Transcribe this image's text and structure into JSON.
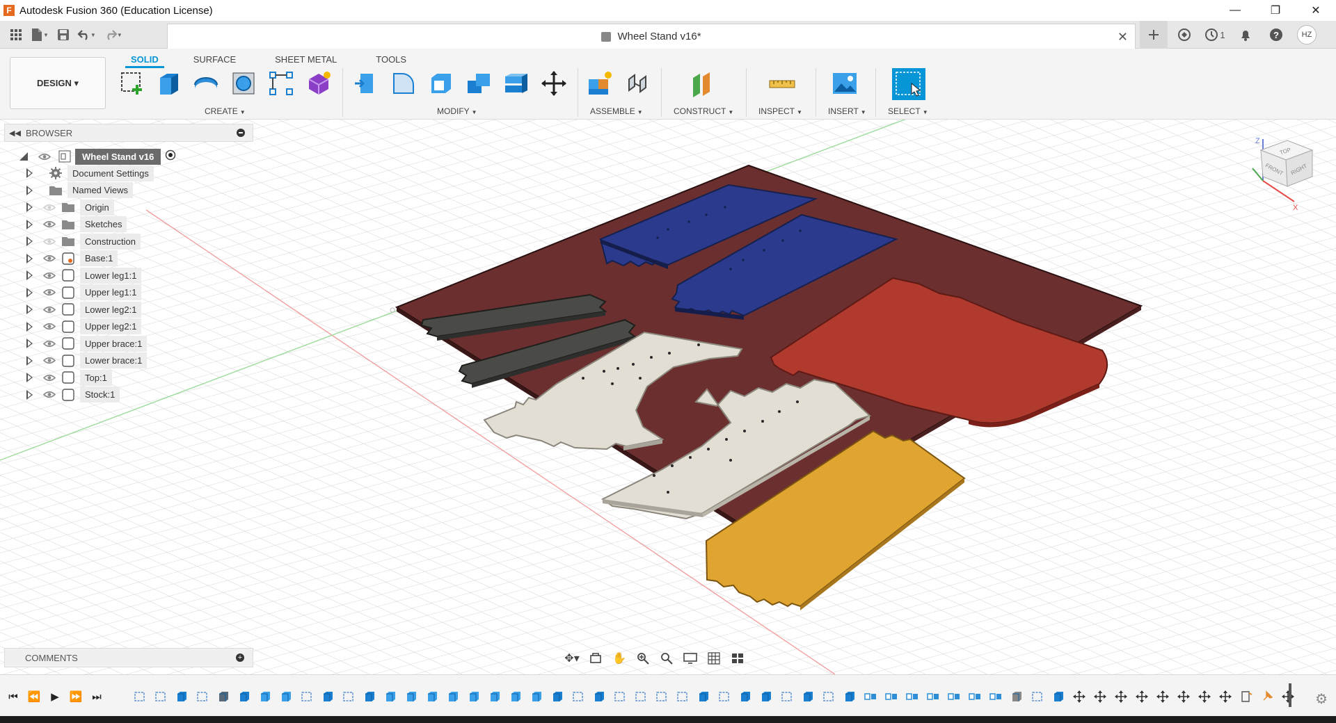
{
  "app": {
    "title": "Autodesk Fusion 360 (Education License)",
    "logo_letter": "F"
  },
  "window_controls": {
    "minimize": "—",
    "maximize": "❐",
    "close": "✕"
  },
  "document": {
    "name": "Wheel Stand v16*",
    "close": "✕"
  },
  "tabstrip_right": {
    "jobs_count": "1",
    "user_initials": "HZ"
  },
  "workspace": {
    "label": "DESIGN ▾"
  },
  "toolbar_tabs": [
    "SOLID",
    "SURFACE",
    "SHEET METAL",
    "TOOLS"
  ],
  "tool_groups": {
    "create": "CREATE",
    "modify": "MODIFY",
    "assemble": "ASSEMBLE",
    "construct": "CONSTRUCT",
    "inspect": "INSPECT",
    "insert": "INSERT",
    "select": "SELECT"
  },
  "browser": {
    "title": "BROWSER",
    "root": "Wheel Stand v16",
    "items": [
      "Document Settings",
      "Named Views",
      "Origin",
      "Sketches",
      "Construction",
      "Base:1",
      "Lower leg1:1",
      "Upper leg1:1",
      "Lower leg2:1",
      "Upper leg2:1",
      "Upper brace:1",
      "Lower brace:1",
      "Top:1",
      "Stock:1"
    ]
  },
  "comments": {
    "title": "COMMENTS"
  },
  "viewcube": {
    "top": "TOP",
    "front": "FRONT",
    "right": "RIGHT",
    "z": "Z",
    "x": "X"
  },
  "colors": {
    "accent": "#0696d7",
    "stock": "#6b2f2f",
    "blue_parts": "#2b3a8c",
    "dark_parts": "#4a4a46",
    "cream_parts": "#e2ded3",
    "red_part": "#b03a2e",
    "yellow_part": "#e0a531"
  }
}
